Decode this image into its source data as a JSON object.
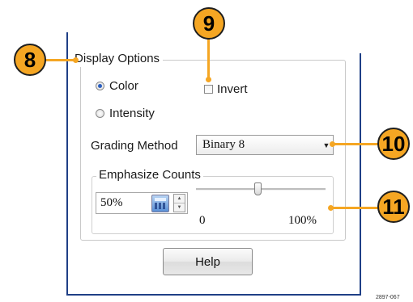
{
  "display_options": {
    "legend": "Display Options",
    "radio_color": "Color",
    "radio_color_selected": true,
    "radio_intensity": "Intensity",
    "radio_intensity_selected": false,
    "invert_label": "Invert",
    "invert_checked": false
  },
  "grading": {
    "label": "Grading Method",
    "selected": "Binary 8"
  },
  "emphasize": {
    "legend": "Emphasize Counts",
    "value_text": "50%",
    "slider_value": 50,
    "min_label": "0",
    "max_label": "100%"
  },
  "help_label": "Help",
  "callouts": {
    "c8": "8",
    "c9": "9",
    "c10": "10",
    "c11": "11"
  },
  "figure_code": "2897-067",
  "colors": {
    "callout": "#f5a623",
    "panel_border": "#1f3f86",
    "radio_selected": "#2b5fc0"
  }
}
